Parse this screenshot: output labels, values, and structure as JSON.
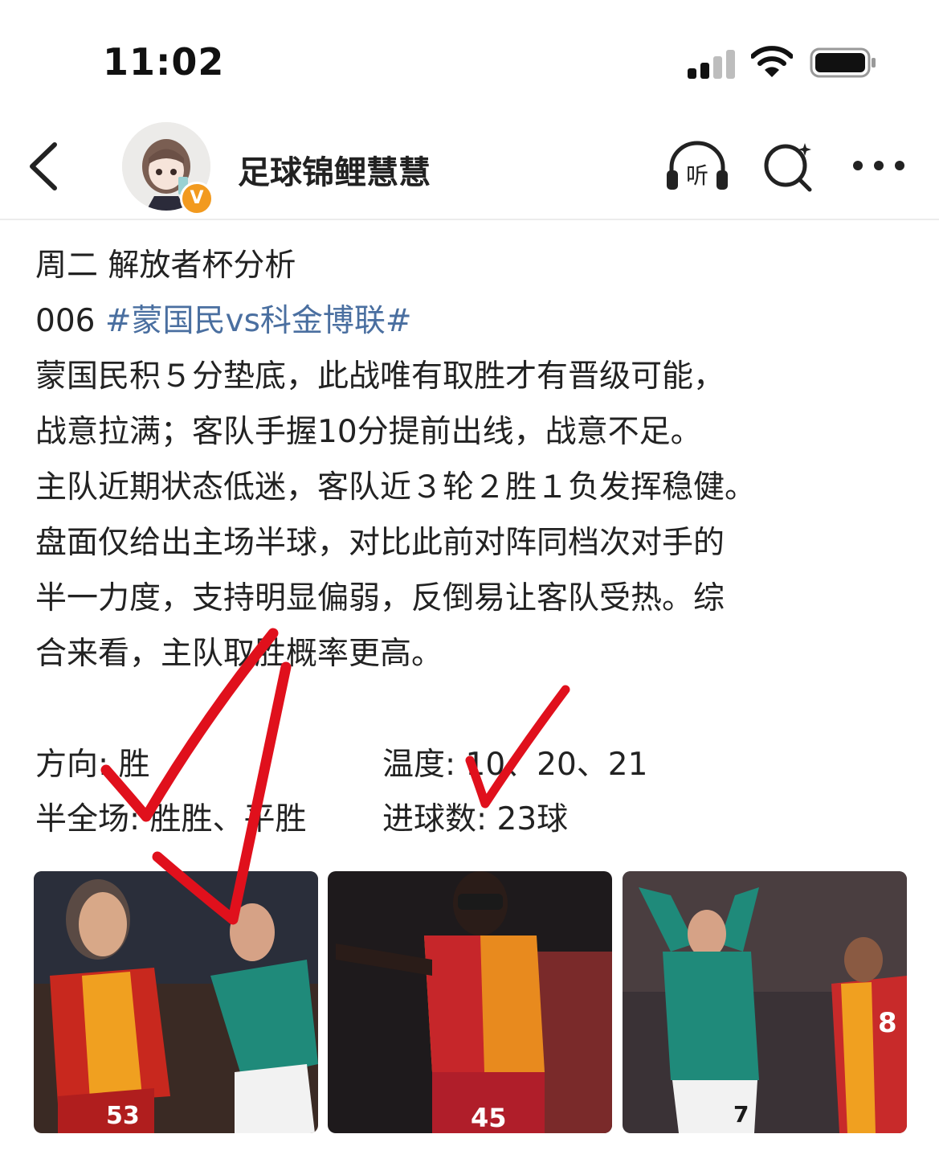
{
  "status_bar": {
    "time": "11:02"
  },
  "header": {
    "account_name": "足球锦鲤慧慧",
    "verified_badge": "V"
  },
  "post": {
    "title": "周二 解放者杯分析",
    "match_number": "006",
    "match_hashtag": "#蒙国民vs科金博联#",
    "lines": [
      "蒙国民积５分垫底，此战唯有取胜才有晋级可能，",
      "战意拉满；客队手握10分提前出线，战意不足。",
      "主队近期状态低迷，客队近３轮２胜１负发挥稳健。",
      "盘面仅给出主场半球，对比此前对阵同档次对手的",
      "半一力度，支持明显偏弱，反倒易让客队受热。综",
      "合来看，主队取胜概率更高。"
    ],
    "stats": {
      "direction": "方向: 胜",
      "temperature": "温度: 10、20、21",
      "half_full": "半全场: 胜胜、平胜",
      "goals": "进球数: 23球"
    }
  },
  "photos": [
    {
      "jersey_number": "53"
    },
    {
      "jersey_number": "45"
    },
    {
      "jersey_number": "7",
      "jersey_number_2": "8"
    }
  ],
  "colors": {
    "hashtag": "#4a6fa0",
    "check_mark": "#e0101c",
    "verified": "#f29a1f"
  }
}
